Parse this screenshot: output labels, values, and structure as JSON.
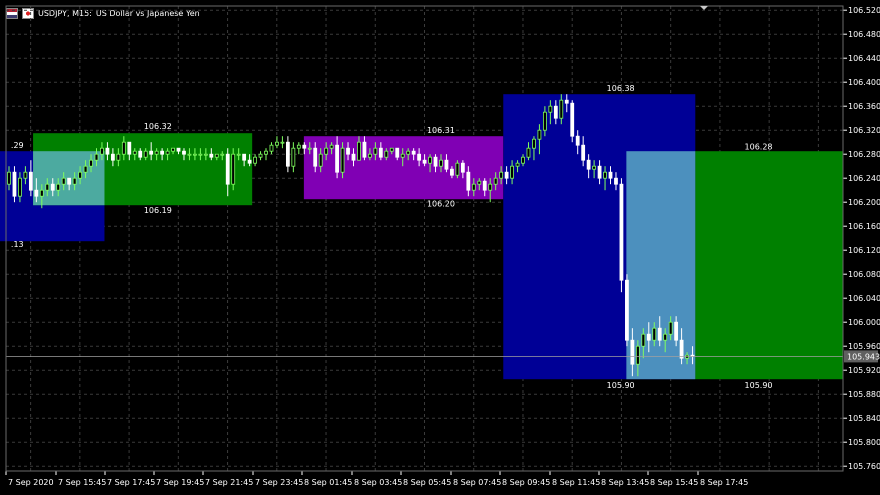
{
  "header": {
    "symbol_label": "USDJPY, M15:",
    "description": "US Dollar vs Japanese Yen"
  },
  "colors": {
    "background": "#000000",
    "grid": "#3b3b3b",
    "candle_up": "#7fff5f",
    "candle_down": "#ffffff",
    "box_green": "#008000",
    "box_blue": "#000096",
    "box_cyan": "#5fb4c8",
    "box_purple": "#8000b4",
    "box_darkred": "#6e0000",
    "price_line": "#a0a0a0"
  },
  "chart_data": {
    "type": "candlestick",
    "y_ticks": [
      "106.520",
      "106.480",
      "106.440",
      "106.400",
      "106.360",
      "106.320",
      "106.280",
      "106.240",
      "106.200",
      "106.160",
      "106.120",
      "106.080",
      "106.040",
      "106.000",
      "105.960",
      "105.920",
      "105.880",
      "105.840",
      "105.800",
      "105.760"
    ],
    "x_ticks": [
      "7 Sep 2020",
      "7 Sep 15:45",
      "7 Sep 17:45",
      "7 Sep 19:45",
      "7 Sep 21:45",
      "7 Sep 23:45",
      "8 Sep 01:45",
      "8 Sep 03:45",
      "8 Sep 05:45",
      "8 Sep 07:45",
      "8 Sep 09:45",
      "8 Sep 11:45",
      "8 Sep 13:45",
      "8 Sep 15:45",
      "8 Sep 17:45"
    ],
    "current_price": "105.943",
    "ylim": [
      105.752,
      106.527
    ],
    "boxes": [
      {
        "color": "box_blue",
        "x0": -0.2,
        "x1": 2.0,
        "y_top": 106.285,
        "y_bottom": 106.135
      },
      {
        "color": "box_green",
        "x0": 0.55,
        "x1": 5.0,
        "y_top": 106.315,
        "y_bottom": 106.195
      },
      {
        "color": "box_cyan",
        "x0": 0.55,
        "x1": 2.0,
        "y_top": 106.285,
        "y_bottom": 106.195
      },
      {
        "color": "box_purple",
        "x0": 6.05,
        "x1": 10.1,
        "y_top": 106.31,
        "y_bottom": 106.205
      },
      {
        "color": "box_darkred",
        "x0": 10.1,
        "x1": 10.72,
        "y_top": 106.31,
        "y_bottom": 106.205
      },
      {
        "color": "box_blue",
        "x0": 10.1,
        "x1": 14.0,
        "y_top": 106.38,
        "y_bottom": 105.905
      },
      {
        "color": "box_green",
        "x0": 14.0,
        "x1": 17.5,
        "y_top": 106.285,
        "y_bottom": 105.905
      },
      {
        "color": "box_cyan",
        "x0": 12.6,
        "x1": 14.0,
        "y_top": 106.285,
        "y_bottom": 105.905
      }
    ],
    "labels": [
      {
        "text": ".29",
        "x": 0.1,
        "price": 106.29
      },
      {
        "text": ".13",
        "x": 0.1,
        "price": 106.125
      },
      {
        "text": "106.32",
        "x": 2.8,
        "price": 106.322
      },
      {
        "text": "106.19",
        "x": 2.8,
        "price": 106.182
      },
      {
        "text": "106.31",
        "x": 8.55,
        "price": 106.315
      },
      {
        "text": "106.20",
        "x": 8.55,
        "price": 106.193
      },
      {
        "text": "106.38",
        "x": 12.2,
        "price": 106.385
      },
      {
        "text": "105.90",
        "x": 12.2,
        "price": 105.89
      },
      {
        "text": "106.28",
        "x": 15.0,
        "price": 106.288
      },
      {
        "text": "105.90",
        "x": 15.0,
        "price": 105.89
      }
    ],
    "candles": [
      [
        106.23,
        106.26,
        106.22,
        106.25
      ],
      [
        106.25,
        106.26,
        106.2,
        106.21
      ],
      [
        106.21,
        106.25,
        106.2,
        106.24
      ],
      [
        106.24,
        106.26,
        106.23,
        106.25
      ],
      [
        106.25,
        106.27,
        106.21,
        106.22
      ],
      [
        106.22,
        106.24,
        106.2,
        106.21
      ],
      [
        106.21,
        106.23,
        106.19,
        106.22
      ],
      [
        106.22,
        106.24,
        106.21,
        106.23
      ],
      [
        106.23,
        106.24,
        106.21,
        106.22
      ],
      [
        106.22,
        106.24,
        106.21,
        106.23
      ],
      [
        106.23,
        106.25,
        106.22,
        106.24
      ],
      [
        106.24,
        106.24,
        106.22,
        106.23
      ],
      [
        106.23,
        106.25,
        106.22,
        106.24
      ],
      [
        106.24,
        106.26,
        106.23,
        106.25
      ],
      [
        106.25,
        106.27,
        106.24,
        106.26
      ],
      [
        106.26,
        106.28,
        106.25,
        106.27
      ],
      [
        106.27,
        106.29,
        106.26,
        106.28
      ],
      [
        106.28,
        106.3,
        106.27,
        106.29
      ],
      [
        106.29,
        106.3,
        106.27,
        106.28
      ],
      [
        106.28,
        106.29,
        106.26,
        106.27
      ],
      [
        106.27,
        106.29,
        106.26,
        106.28
      ],
      [
        106.28,
        106.31,
        106.27,
        106.3
      ],
      [
        106.3,
        106.3,
        106.27,
        106.28
      ],
      [
        106.28,
        106.29,
        106.27,
        106.285
      ],
      [
        106.285,
        106.29,
        106.27,
        106.275
      ],
      [
        106.275,
        106.29,
        106.27,
        106.285
      ],
      [
        106.285,
        106.3,
        106.27,
        106.28
      ],
      [
        106.28,
        106.29,
        106.27,
        106.285
      ],
      [
        106.285,
        106.29,
        106.27,
        106.28
      ],
      [
        106.28,
        106.29,
        106.27,
        106.285
      ],
      [
        106.285,
        106.29,
        106.28,
        106.29
      ],
      [
        106.29,
        106.29,
        106.28,
        106.285
      ],
      [
        106.285,
        106.29,
        106.27,
        106.28
      ],
      [
        106.28,
        106.29,
        106.27,
        106.28
      ],
      [
        106.28,
        106.29,
        106.27,
        106.28
      ],
      [
        106.28,
        106.29,
        106.27,
        106.28
      ],
      [
        106.28,
        106.29,
        106.27,
        106.28
      ],
      [
        106.28,
        106.29,
        106.27,
        106.275
      ],
      [
        106.275,
        106.28,
        106.27,
        106.28
      ],
      [
        106.28,
        106.285,
        106.27,
        106.28
      ],
      [
        106.28,
        106.29,
        106.21,
        106.23
      ],
      [
        106.23,
        106.29,
        106.22,
        106.28
      ],
      [
        106.28,
        106.29,
        106.27,
        106.28
      ],
      [
        106.28,
        106.28,
        106.26,
        106.27
      ],
      [
        106.27,
        106.28,
        106.26,
        106.265
      ],
      [
        106.265,
        106.28,
        106.26,
        106.275
      ],
      [
        106.275,
        106.285,
        106.27,
        106.28
      ],
      [
        106.28,
        106.29,
        106.27,
        106.285
      ],
      [
        106.285,
        106.3,
        106.28,
        106.295
      ],
      [
        106.295,
        106.31,
        106.29,
        106.3
      ],
      [
        106.3,
        106.31,
        106.29,
        106.3
      ],
      [
        106.3,
        106.31,
        106.25,
        106.26
      ],
      [
        106.26,
        106.3,
        106.25,
        106.29
      ],
      [
        106.29,
        106.3,
        106.28,
        106.295
      ],
      [
        106.295,
        106.3,
        106.28,
        106.29
      ],
      [
        106.29,
        106.3,
        106.28,
        106.29
      ],
      [
        106.29,
        106.3,
        106.25,
        106.26
      ],
      [
        106.26,
        106.29,
        106.25,
        106.28
      ],
      [
        106.28,
        106.3,
        106.27,
        106.29
      ],
      [
        106.29,
        106.3,
        106.28,
        106.295
      ],
      [
        106.295,
        106.31,
        106.24,
        106.25
      ],
      [
        106.25,
        106.3,
        106.24,
        106.29
      ],
      [
        106.29,
        106.3,
        106.27,
        106.28
      ],
      [
        106.28,
        106.29,
        106.26,
        106.27
      ],
      [
        106.27,
        106.31,
        106.27,
        106.3
      ],
      [
        106.3,
        106.31,
        106.27,
        106.275
      ],
      [
        106.275,
        106.29,
        106.27,
        106.28
      ],
      [
        106.28,
        106.3,
        106.27,
        106.29
      ],
      [
        106.29,
        106.3,
        106.27,
        106.275
      ],
      [
        106.275,
        106.29,
        106.27,
        106.285
      ],
      [
        106.285,
        106.29,
        106.28,
        106.29
      ],
      [
        106.29,
        106.29,
        106.27,
        106.275
      ],
      [
        106.275,
        106.29,
        106.26,
        106.28
      ],
      [
        106.28,
        106.29,
        106.27,
        106.285
      ],
      [
        106.285,
        106.29,
        106.27,
        106.28
      ],
      [
        106.28,
        106.29,
        106.26,
        106.27
      ],
      [
        106.27,
        106.28,
        106.26,
        106.265
      ],
      [
        106.265,
        106.28,
        106.25,
        106.275
      ],
      [
        106.275,
        106.28,
        106.25,
        106.26
      ],
      [
        106.26,
        106.28,
        106.25,
        106.27
      ],
      [
        106.27,
        106.28,
        106.25,
        106.255
      ],
      [
        106.255,
        106.26,
        106.24,
        106.245
      ],
      [
        106.245,
        106.27,
        106.24,
        106.265
      ],
      [
        106.265,
        106.27,
        106.24,
        106.25
      ],
      [
        106.25,
        106.26,
        106.21,
        106.22
      ],
      [
        106.22,
        106.24,
        106.21,
        106.23
      ],
      [
        106.23,
        106.24,
        106.22,
        106.235
      ],
      [
        106.235,
        106.24,
        106.21,
        106.22
      ],
      [
        106.22,
        106.24,
        106.2,
        106.23
      ],
      [
        106.23,
        106.25,
        106.22,
        106.24
      ],
      [
        106.24,
        106.26,
        106.23,
        106.25
      ],
      [
        106.25,
        106.26,
        106.23,
        106.24
      ],
      [
        106.24,
        106.27,
        106.23,
        106.26
      ],
      [
        106.26,
        106.27,
        106.25,
        106.265
      ],
      [
        106.265,
        106.28,
        106.26,
        106.275
      ],
      [
        106.275,
        106.3,
        106.27,
        106.29
      ],
      [
        106.29,
        106.31,
        106.27,
        106.305
      ],
      [
        106.305,
        106.33,
        106.28,
        106.32
      ],
      [
        106.32,
        106.36,
        106.31,
        106.35
      ],
      [
        106.35,
        106.37,
        106.33,
        106.36
      ],
      [
        106.36,
        106.37,
        106.33,
        106.34
      ],
      [
        106.34,
        106.38,
        106.33,
        106.37
      ],
      [
        106.37,
        106.38,
        106.35,
        106.365
      ],
      [
        106.365,
        106.37,
        106.3,
        106.31
      ],
      [
        106.31,
        106.32,
        106.28,
        106.295
      ],
      [
        106.295,
        106.31,
        106.26,
        106.27
      ],
      [
        106.27,
        106.28,
        106.24,
        106.255
      ],
      [
        106.255,
        106.27,
        106.24,
        106.26
      ],
      [
        106.26,
        106.27,
        106.23,
        106.24
      ],
      [
        106.24,
        106.26,
        106.22,
        106.25
      ],
      [
        106.25,
        106.26,
        106.23,
        106.24
      ],
      [
        106.24,
        106.25,
        106.22,
        106.23
      ],
      [
        106.23,
        106.24,
        106.05,
        106.07
      ],
      [
        106.07,
        106.08,
        105.96,
        105.97
      ],
      [
        105.97,
        105.99,
        105.91,
        105.93
      ],
      [
        105.93,
        105.97,
        105.91,
        105.96
      ],
      [
        105.96,
        105.99,
        105.94,
        105.98
      ],
      [
        105.98,
        106.0,
        105.95,
        105.97
      ],
      [
        105.97,
        106.0,
        105.96,
        105.99
      ],
      [
        105.99,
        106.01,
        105.96,
        105.97
      ],
      [
        105.97,
        105.99,
        105.95,
        105.98
      ],
      [
        105.98,
        106.01,
        105.97,
        106.0
      ],
      [
        106.0,
        106.01,
        105.96,
        105.97
      ],
      [
        105.97,
        105.99,
        105.93,
        105.94
      ],
      [
        105.94,
        105.95,
        105.93,
        105.945
      ],
      [
        105.945,
        105.96,
        105.93,
        105.943
      ]
    ]
  }
}
